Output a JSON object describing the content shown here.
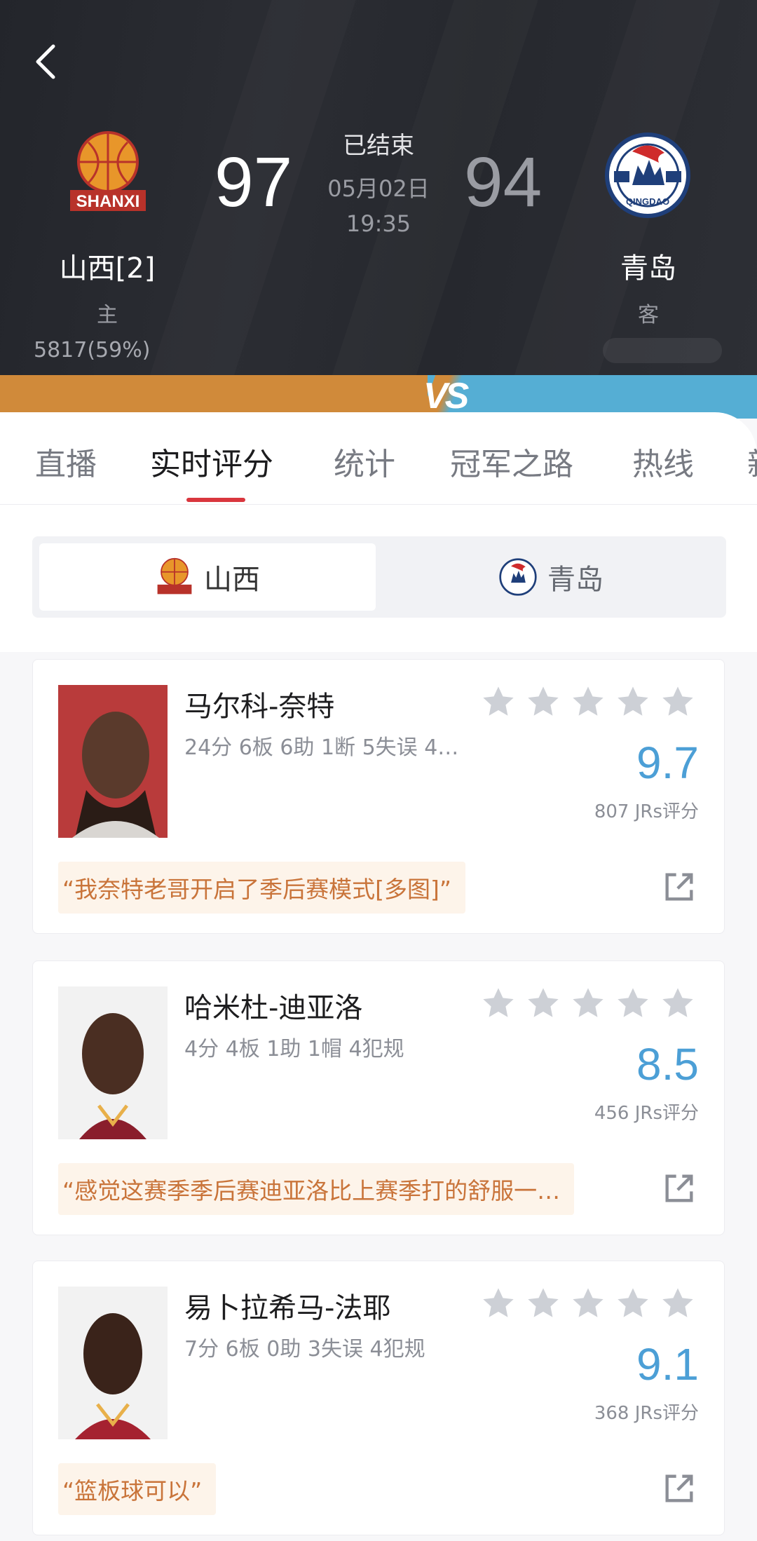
{
  "header": {
    "home": {
      "name": "山西[2]",
      "role": "主",
      "support": "5817(59%)",
      "score": "97",
      "logo_text": "SHANXI"
    },
    "away": {
      "name": "青岛",
      "role": "客",
      "score": "94",
      "logo_text": "QINGDAO"
    },
    "status": "已结束",
    "date": "05月02日",
    "time": "19:35",
    "vs_text": "VS"
  },
  "tabs": [
    {
      "label": "直播"
    },
    {
      "label": "实时评分"
    },
    {
      "label": "统计"
    },
    {
      "label": "冠军之路"
    },
    {
      "label": "热线"
    },
    {
      "label": "新"
    }
  ],
  "team_toggle": {
    "home": "山西",
    "away": "青岛"
  },
  "players": [
    {
      "name": "马尔科-奈特",
      "stats": "24分 6板 6助 1断 5失误 4…",
      "rating": "9.7",
      "count": "807 JRs评分",
      "comment": "“我奈特老哥开启了季后赛模式[多图]”"
    },
    {
      "name": "哈米杜-迪亚洛",
      "stats": "4分 4板 1助 1帽 4犯规",
      "rating": "8.5",
      "count": "456 JRs评分",
      "comment": "“感觉这赛季季后赛迪亚洛比上赛季打的舒服一…"
    },
    {
      "name": "易卜拉希马-法耶",
      "stats": "7分 6板 0助 3失误 4犯规",
      "rating": "9.1",
      "count": "368 JRs评分",
      "comment": "“篮板球可以”"
    }
  ],
  "colors": {
    "header_bg": "#26282e",
    "home_accent": "#d08a3a",
    "away_accent": "#55aed4",
    "rating": "#4c9fd6",
    "tab_indicator": "#d9363e",
    "comment_text": "#c9743a",
    "comment_bg": "#fdf4ea"
  },
  "icons": {
    "back": "chevron-left-icon",
    "star": "star-icon",
    "share": "share-icon"
  }
}
